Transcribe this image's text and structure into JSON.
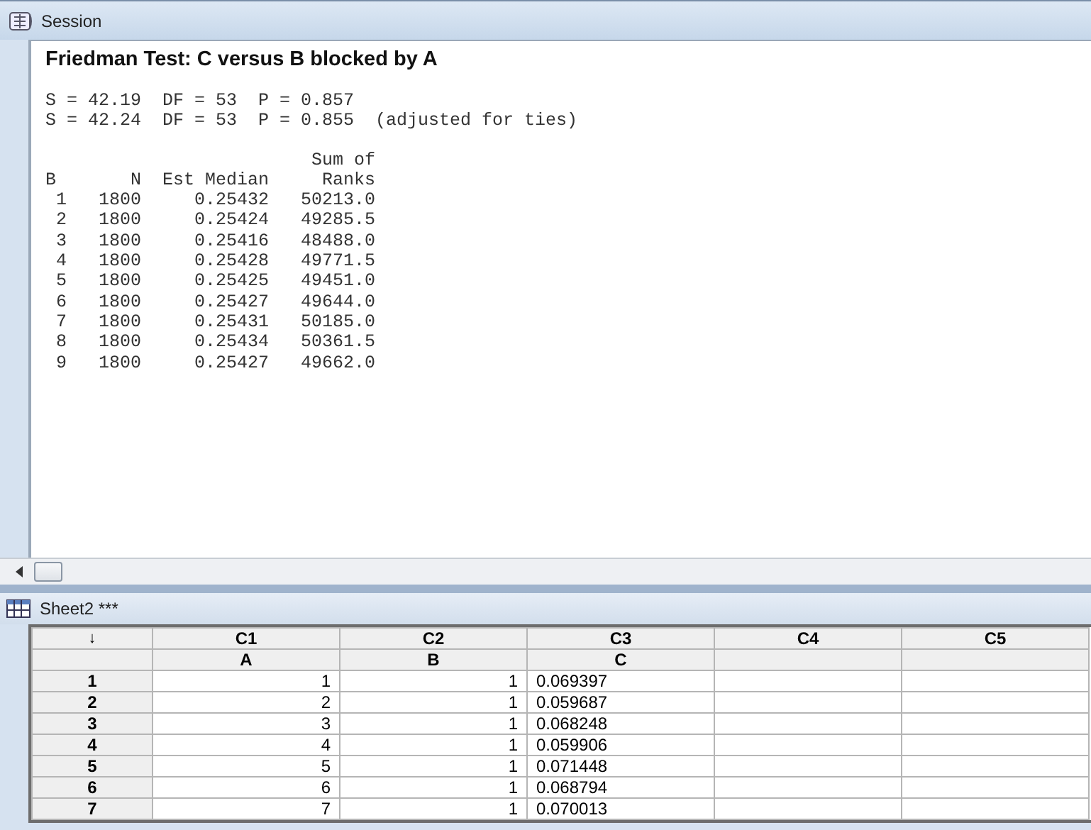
{
  "session": {
    "title": "Session",
    "heading": "Friedman Test: C versus B blocked by A",
    "stats": [
      "S = 42.19  DF = 53  P = 0.857",
      "S = 42.24  DF = 53  P = 0.855  (adjusted for ties)"
    ],
    "table_lines": [
      "                         Sum of",
      "B       N  Est Median     Ranks",
      " 1   1800     0.25432   50213.0",
      " 2   1800     0.25424   49285.5",
      " 3   1800     0.25416   48488.0",
      " 4   1800     0.25428   49771.5",
      " 5   1800     0.25425   49451.0",
      " 6   1800     0.25427   49644.0",
      " 7   1800     0.25431   50185.0",
      " 8   1800     0.25434   50361.5",
      " 9   1800     0.25427   49662.0"
    ]
  },
  "worksheet": {
    "title": "Sheet2 ***",
    "corner": "↓",
    "columns": [
      {
        "id": "C1",
        "name": "A"
      },
      {
        "id": "C2",
        "name": "B"
      },
      {
        "id": "C3",
        "name": "C"
      },
      {
        "id": "C4"
      },
      {
        "id": "C5"
      }
    ],
    "rows": [
      {
        "number": "1",
        "cells": [
          "1",
          "1",
          "0.069397"
        ]
      },
      {
        "number": "2",
        "cells": [
          "2",
          "1",
          "0.059687"
        ]
      },
      {
        "number": "3",
        "cells": [
          "3",
          "1",
          "0.068248"
        ]
      },
      {
        "number": "4",
        "cells": [
          "4",
          "1",
          "0.059906"
        ]
      },
      {
        "number": "5",
        "cells": [
          "5",
          "1",
          "0.071448"
        ]
      },
      {
        "number": "6",
        "cells": [
          "6",
          "1",
          "0.068794"
        ]
      },
      {
        "number": "7",
        "cells": [
          "7",
          "1",
          "0.070013"
        ]
      }
    ]
  }
}
